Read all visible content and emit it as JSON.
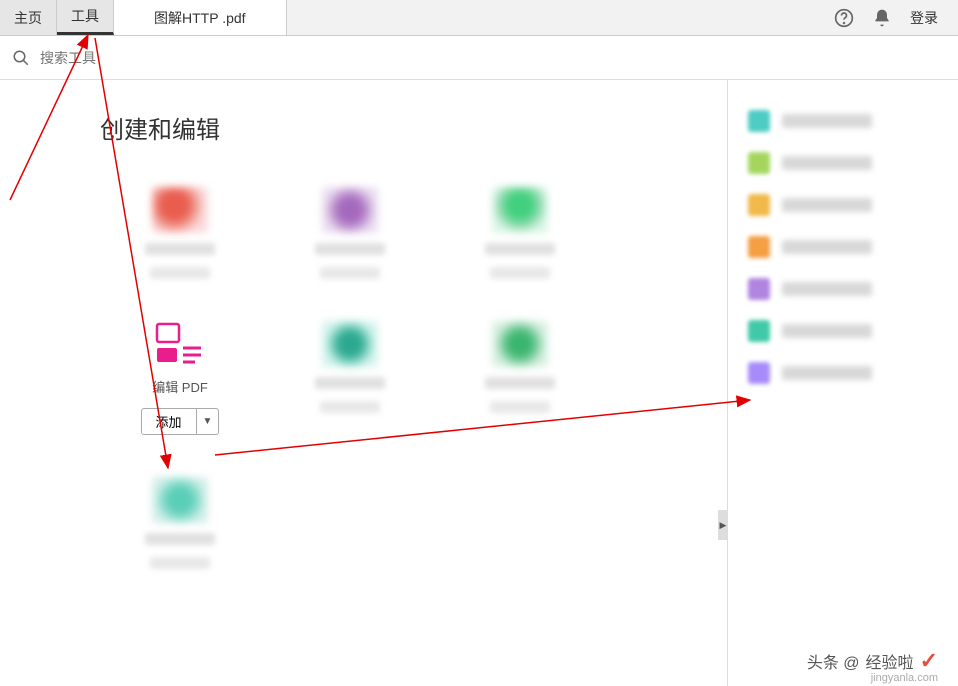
{
  "topbar": {
    "tabs": {
      "home": "主页",
      "tools": "工具",
      "document": "图解HTTP .pdf"
    },
    "login": "登录"
  },
  "search": {
    "placeholder": "搜索工具"
  },
  "section": {
    "title": "创建和编辑"
  },
  "tools_grid": {
    "edit_pdf": {
      "label": "编辑 PDF",
      "add_button": "添加"
    }
  },
  "sidepanel": {
    "items_count": 7
  },
  "watermark": {
    "prefix": "头条 @",
    "name": "经验啦",
    "site": "jingyanla.com"
  }
}
